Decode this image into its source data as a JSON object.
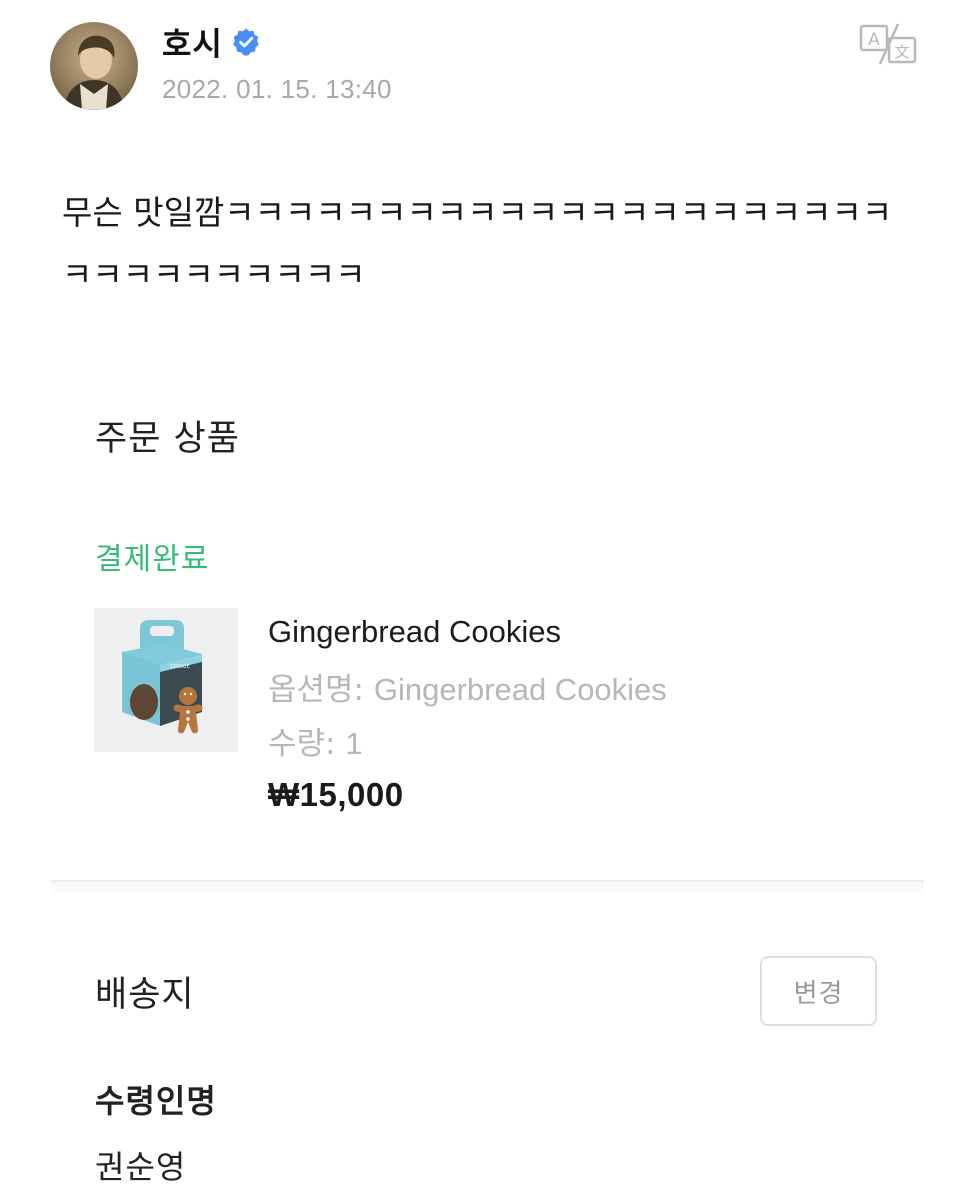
{
  "post": {
    "author_name": "호시",
    "timestamp": "2022. 01. 15. 13:40",
    "text": "무슨 맛일깜ㅋㅋㅋㅋㅋㅋㅋㅋㅋㅋㅋㅋㅋㅋㅋㅋㅋㅋㅋㅋㅋㅋㅋㅋㅋㅋㅋㅋㅋㅋㅋㅋ",
    "icons": {
      "verified": "verified-badge-icon",
      "translate": "translate-icon"
    }
  },
  "order": {
    "title": "주문 상품",
    "status": "결제완료",
    "item": {
      "name": "Gingerbread Cookies",
      "option_label": "옵션명: ",
      "option_value": "Gingerbread Cookies",
      "quantity_label": "수량: ",
      "quantity_value": "1",
      "price": "₩15,000"
    }
  },
  "shipping": {
    "title": "배송지",
    "change_label": "변경",
    "recipient_label": "수령인명",
    "recipient_name": "권순영"
  },
  "colors": {
    "status_green": "#38bb78",
    "verified_blue": "#4a8df6",
    "muted_text": "#b7b7b7"
  }
}
